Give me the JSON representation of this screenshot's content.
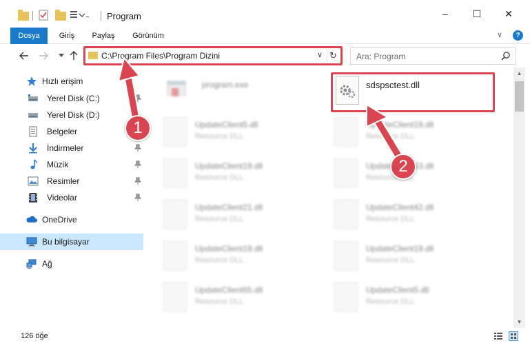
{
  "window": {
    "title": "Program",
    "minimize": "–",
    "maximize": "☐",
    "close": "✕"
  },
  "ribbon": {
    "tabs": [
      "Dosya",
      "Giriş",
      "Paylaş",
      "Görünüm"
    ],
    "collapse": "∨",
    "help": "?"
  },
  "address": {
    "path": "C:\\Program Files\\Program Dizini",
    "dropdown": "∨",
    "refresh": "↻"
  },
  "search": {
    "placeholder": "Ara: Program"
  },
  "nav": {
    "quick_access": "Hızlı erişim",
    "items": [
      {
        "label": "Yerel Disk (C:)",
        "pinned": true
      },
      {
        "label": "Yerel Disk (D:)",
        "pinned": true
      },
      {
        "label": "Belgeler",
        "pinned": true
      },
      {
        "label": "İndirmeler",
        "pinned": true
      },
      {
        "label": "Müzik",
        "pinned": true
      },
      {
        "label": "Resimler",
        "pinned": true
      },
      {
        "label": "Videolar",
        "pinned": true
      }
    ],
    "onedrive": "OneDrive",
    "this_pc": "Bu bilgisayar",
    "network": "Ağ"
  },
  "files": {
    "highlighted": {
      "name": "sdspsctest.dll"
    },
    "items": [
      {
        "name": "program.exe",
        "desc": ""
      },
      {
        "name": "UpdateClient5.dll",
        "desc": "Resource DLL"
      },
      {
        "name": "UpdateClient19.dll",
        "desc": "Resource DLL"
      },
      {
        "name": "UpdateClient19.dll",
        "desc": "Resource DLL"
      },
      {
        "name": "UpdateClient63.dll",
        "desc": "Resource DLL"
      },
      {
        "name": "UpdateClient21.dll",
        "desc": "Resource DLL"
      },
      {
        "name": "UpdateClient42.dll",
        "desc": "Resource DLL"
      },
      {
        "name": "UpdateClient19.dll",
        "desc": "Resource DLL"
      },
      {
        "name": "UpdateClient19.dll",
        "desc": "Resource DLL"
      },
      {
        "name": "UpdateClient65.dll",
        "desc": "Resource DLL"
      },
      {
        "name": "UpdateClient5.dll",
        "desc": "Resource DLL"
      }
    ]
  },
  "status": {
    "count": "126 öğe"
  },
  "annotations": {
    "step1": "1",
    "step2": "2",
    "color": "#d94652"
  },
  "colors": {
    "accent": "#1979ca",
    "selected_bg": "#cce8ff",
    "highlight": "#d94652"
  }
}
